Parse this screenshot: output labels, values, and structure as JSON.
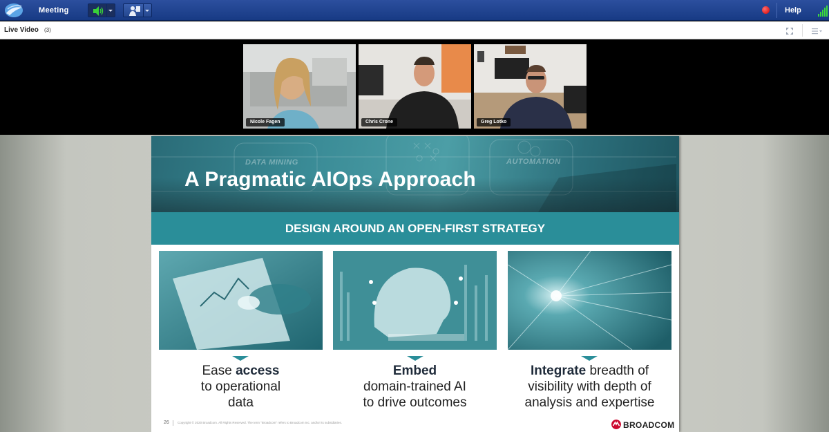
{
  "toolbar": {
    "menu_meeting": "Meeting",
    "help_label": "Help",
    "colors": {
      "background": "#1f4390",
      "audio_active": "#39d239",
      "record": "#e00000",
      "signal": "#3bdc3b"
    },
    "icons": [
      "app-logo-icon",
      "speaker-icon",
      "share-presenter-icon",
      "record-icon",
      "signal-strength-icon"
    ]
  },
  "live_video": {
    "title": "Live Video",
    "count": "(3)",
    "participants": [
      {
        "name": "Nicole Fagen"
      },
      {
        "name": "Chris Crone"
      },
      {
        "name": "Greg Lotko"
      }
    ]
  },
  "slide": {
    "title": "A Pragmatic AIOps Approach",
    "banner_ghost_text": [
      "DATA MINING",
      "AUTOMATION"
    ],
    "subtitle": "DESIGN AROUND AN OPEN-FIRST STRATEGY",
    "cards": [
      {
        "emphasis": "Ease",
        "bold": "access",
        "line1_rest": "",
        "line2": "to operational",
        "line3": "data"
      },
      {
        "emphasis": "",
        "bold": "Embed",
        "line1_rest": "",
        "line2": "domain-trained AI",
        "line3": "to drive outcomes"
      },
      {
        "emphasis": "",
        "bold": "Integrate",
        "line1_rest": " breadth of",
        "line2": "visibility with depth of",
        "line3": "analysis and expertise"
      }
    ],
    "page_number": "26",
    "copyright": "Copyright © 2020 Broadcom. All Rights Reserved. The term \"Broadcom\" refers to Broadcom Inc. and/or its subsidiaries.",
    "brand": "BROADCOM",
    "colors": {
      "accent": "#2a8e99",
      "brand_red": "#cc092f"
    }
  }
}
